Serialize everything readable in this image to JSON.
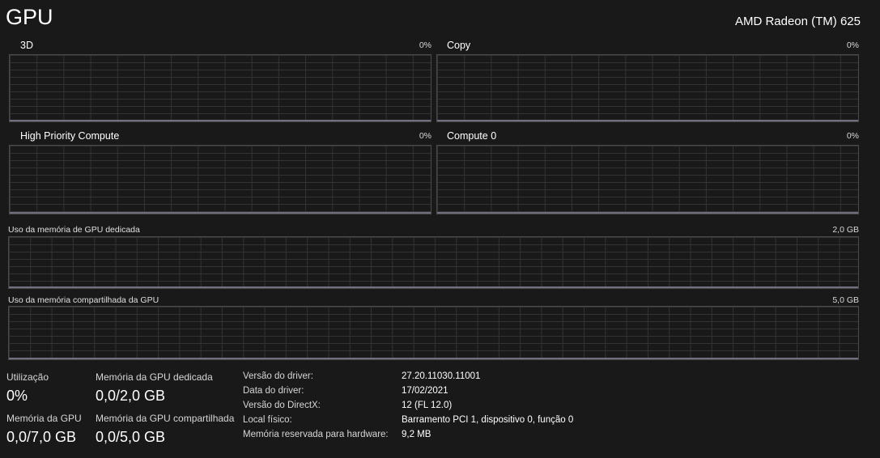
{
  "header": {
    "title": "GPU",
    "device_name": "AMD Radeon (TM) 625"
  },
  "engines": [
    {
      "label": "3D",
      "max": "0%"
    },
    {
      "label": "Copy",
      "max": "0%"
    },
    {
      "label": "High Priority Compute",
      "max": "0%"
    },
    {
      "label": "Compute 0",
      "max": "0%"
    }
  ],
  "memory_graphs": [
    {
      "label": "Uso da memória de GPU dedicada",
      "max": "2,0 GB"
    },
    {
      "label": "Uso da memória compartilhada da GPU",
      "max": "5,0 GB"
    }
  ],
  "stats": {
    "utilization": {
      "label": "Utilização",
      "value": "0%"
    },
    "dedicated_memory": {
      "label": "Memória da GPU dedicada",
      "value": "0,0/2,0 GB"
    },
    "gpu_memory": {
      "label": "Memória da GPU",
      "value": "0,0/7,0 GB"
    },
    "shared_memory": {
      "label": "Memória da GPU compartilhada",
      "value": "0,0/5,0 GB"
    }
  },
  "properties": [
    {
      "label": "Versão do driver:",
      "value": "27.20.11030.11001"
    },
    {
      "label": "Data do driver:",
      "value": "17/02/2021"
    },
    {
      "label": "Versão do DirectX:",
      "value": "12 (FL 12.0)"
    },
    {
      "label": "Local físico:",
      "value": "Barramento PCI 1, dispositivo 0, função 0"
    },
    {
      "label": "Memória reservada para hardware:",
      "value": "9,2 MB"
    }
  ]
}
